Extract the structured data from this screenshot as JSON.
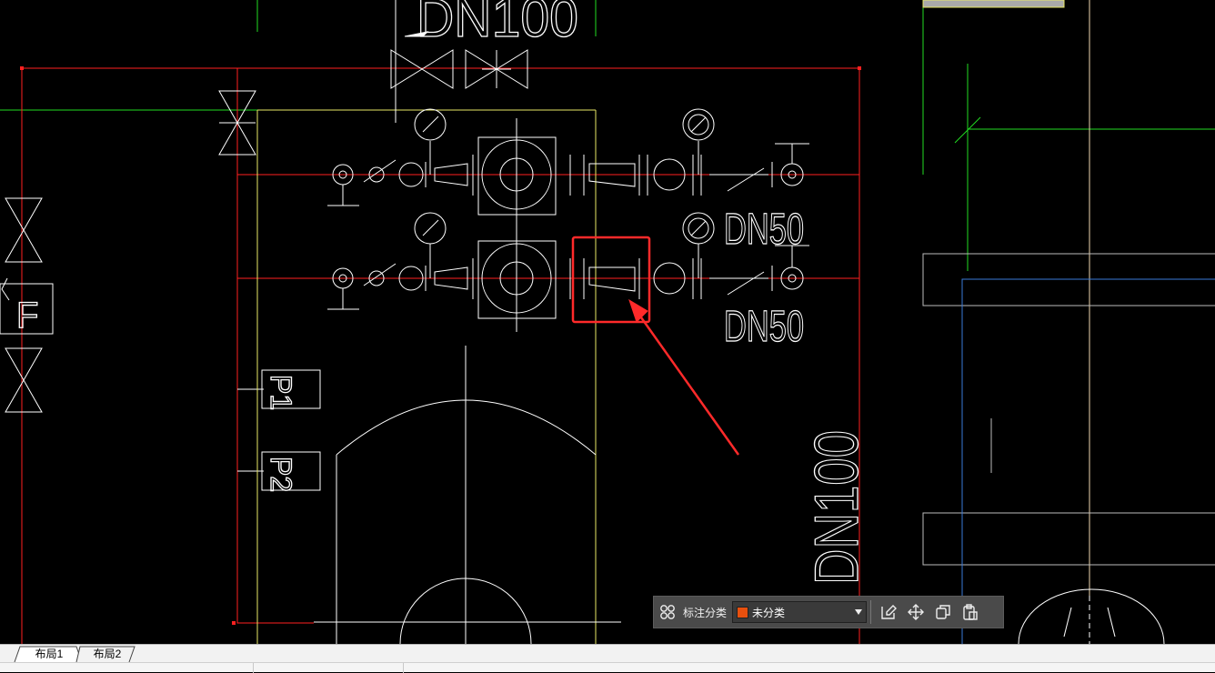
{
  "drawing": {
    "dn_labels": [
      "DN100",
      "DN50",
      "DN50",
      "DN100"
    ],
    "p_labels": [
      "P1",
      "P2"
    ],
    "f_label": "F"
  },
  "toolbar": {
    "category_label": "标注分类",
    "category_value": "未分类",
    "category_color": "#e8500e",
    "icons": [
      "apps-grid-icon",
      "edit-icon",
      "move-icon",
      "copy-icon",
      "paste-icon"
    ]
  },
  "tabs": [
    "布局1",
    "布局2"
  ],
  "colors": {
    "pipe_red": "#ff2020",
    "highlight_box": "#ff2a2a",
    "line_green": "#22dd22",
    "line_yellow": "#e8e866",
    "line_blue": "#3a7ad8"
  }
}
